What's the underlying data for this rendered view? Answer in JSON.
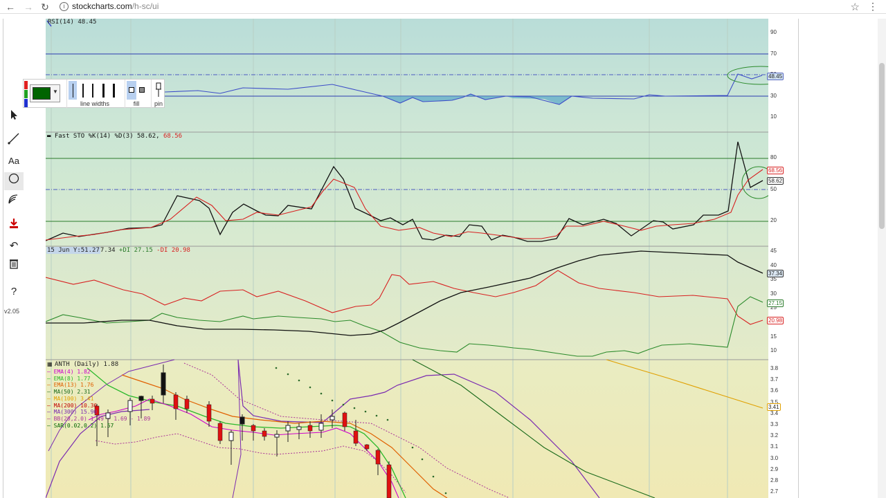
{
  "browser": {
    "url_host": "stockcharts.com",
    "url_path": "/h-sc/ui"
  },
  "toolbar": {
    "version": "v2.05"
  },
  "popup": {
    "line_widths_label": "line widths",
    "fill_label": "fill",
    "pin_label": "pin",
    "color": "#006400"
  },
  "panes": {
    "rsi": {
      "label": "RSI(14) 48.45",
      "value_tag": "48.45",
      "ticks": [
        "90",
        "70",
        "50",
        "30",
        "10"
      ]
    },
    "sto": {
      "label_prefix": "Fast STO %K(14) %D(3) 58.62,",
      "label_d": "68.56",
      "tag_k": "58.62",
      "tag_d": "68.56",
      "ticks": [
        "80",
        "50",
        "20"
      ]
    },
    "adx": {
      "date_tag": "15 Jun Y:51.27",
      "label_mid": "7.34",
      "label_plus": "+DI 27.15",
      "label_minus": "-DI 20.98",
      "tag_adx": "37.34",
      "tag_plus": "27.15",
      "tag_minus": "20.98",
      "ticks": [
        "45",
        "40",
        "35",
        "30",
        "25",
        "20",
        "15",
        "10"
      ]
    },
    "price": {
      "title": "ANTH (Daily) 1.88",
      "legend": [
        {
          "text": "EMA(4) 1.82",
          "color": "#cc00cc"
        },
        {
          "text": "EMA(8) 1.77",
          "color": "#2ab82a"
        },
        {
          "text": "EMA(13) 1.76",
          "color": "#e06000"
        },
        {
          "text": "MA(50) 2.31",
          "color": "#1a6a1a"
        },
        {
          "text": "MA(100) 3.41",
          "color": "#e0a000"
        },
        {
          "text": "MA(200) 10.36",
          "color": "#c00000"
        },
        {
          "text": "MA(300) 15.90",
          "color": "#7a2ab0"
        },
        {
          "text": "BB(20,2.0) 1.49 - 1.69 - 1.89",
          "color": "#aa3399"
        },
        {
          "text": "SAR(0.02,0.2) 1.57",
          "color": "#006600"
        }
      ],
      "tag_ma": "3.41",
      "ticks": [
        "3.8",
        "3.7",
        "3.6",
        "3.5",
        "3.4",
        "3.3",
        "3.2",
        "3.1",
        "3.0",
        "2.9",
        "2.8",
        "2.7"
      ]
    }
  }
}
